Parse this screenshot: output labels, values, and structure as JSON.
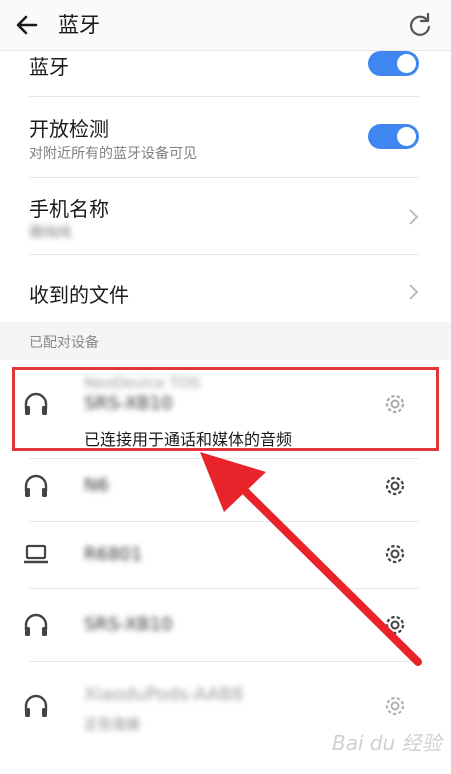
{
  "header": {
    "title": "蓝牙",
    "back_icon": "back-arrow-icon",
    "refresh_icon": "refresh-icon"
  },
  "settings": {
    "bluetooth": {
      "label": "蓝牙",
      "enabled": true
    },
    "discoverable": {
      "label": "开放检测",
      "description": "对附近所有的蓝牙设备可见",
      "enabled": true
    },
    "device_name": {
      "label": "手机名称",
      "value": "薇纯纯"
    },
    "received_files": {
      "label": "收到的文件"
    }
  },
  "paired_devices": {
    "header": "已配对设备",
    "items": [
      {
        "top_name": "NeoDevice TOS",
        "name": "SRS-XB10",
        "status": "已连接用于通话和媒体的音频",
        "icon": "headphones-icon"
      },
      {
        "name": "N6",
        "icon": "headphones-icon"
      },
      {
        "name": "R6801",
        "icon": "laptop-icon"
      },
      {
        "name": "SRS-XB10",
        "icon": "headphones-icon"
      },
      {
        "name": "XiaoduPods-AAB8",
        "sub": "正在连接",
        "icon": "headphones-icon"
      }
    ]
  },
  "watermark": "Bai du 经验",
  "colors": {
    "toggle_on": "#3f86f1",
    "highlight": "#e2363a",
    "arrow": "#e8232a"
  }
}
